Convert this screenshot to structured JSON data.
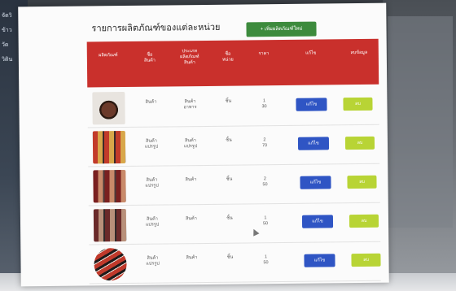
{
  "page": {
    "title": "รายการผลิตภัณฑ์ของแต่ละหน่วย",
    "add_button_label": "+ เพิ่มผลิตภัณฑ์ใหม่",
    "left_edge_labels": [
      "จัดวิ",
      "ข้าว",
      "วัด",
      "วิติน"
    ]
  },
  "table": {
    "headers": [
      "ผลิตภัณฑ์",
      "ชื่อ\nสินค้า",
      "ประเภท\nผลิตภัณฑ์\nสินค้า",
      "ชื่อ\nหน่วย",
      "ราคา",
      "แก้ไข",
      "ลบข้อมูล"
    ],
    "rows": [
      {
        "product_name": "สินค้า",
        "category": "สินค้า\nอาหาร",
        "unit": "ชิ้น",
        "price": "1\n30",
        "thumb_colors": [
          "#e8e4df",
          "#6b3a2a",
          "#2b1a12"
        ],
        "edit_label": "แก้ไข",
        "delete_label": "ลบ"
      },
      {
        "product_name": "สินค้า\nแปรรูป",
        "category": "สินค้า\nแปรรูป",
        "unit": "ชิ้น",
        "price": "2\n70",
        "thumb_colors": [
          "#c23b2a",
          "#d8a74a",
          "#3b2a2a"
        ],
        "edit_label": "แก้ไข",
        "delete_label": "ลบ"
      },
      {
        "product_name": "สินค้า\nแปรรูป",
        "category": "สินค้า",
        "unit": "ชิ้น",
        "price": "2\n50",
        "thumb_colors": [
          "#7a2020",
          "#c98a6a",
          "#4a3a3a"
        ],
        "edit_label": "แก้ไข",
        "delete_label": "ลบ"
      },
      {
        "product_name": "สินค้า\nแปรรูป",
        "category": "สินค้า",
        "unit": "ชิ้น",
        "price": "1\n50",
        "thumb_colors": [
          "#6a2a2a",
          "#b8907a",
          "#2f2a2a"
        ],
        "edit_label": "แก้ไข",
        "delete_label": "ลบ"
      },
      {
        "product_name": "สินค้า\nแปรรูป",
        "category": "สินค้า",
        "unit": "ชิ้น",
        "price": "1\n50",
        "thumb_colors": [
          "#c0392b",
          "#1f1a1a",
          "#e8e0d8"
        ],
        "edit_label": "แก้ไข",
        "delete_label": "ลบ"
      }
    ]
  },
  "colors": {
    "header_red": "#c9302c",
    "add_green": "#3d8b3d",
    "edit_blue": "#2f55c4",
    "delete_lime": "#b8d435"
  }
}
